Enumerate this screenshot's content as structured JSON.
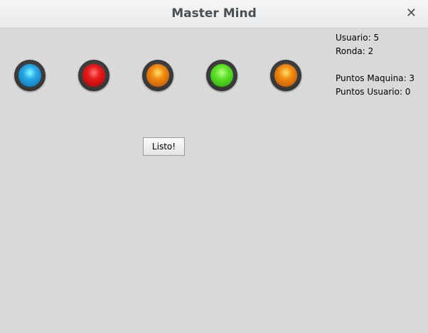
{
  "window": {
    "title": "Master Mind",
    "close_icon": "close-icon"
  },
  "pegs": [
    {
      "color_name": "blue",
      "color": "#2aa8e8"
    },
    {
      "color_name": "red",
      "color": "#e81c1c"
    },
    {
      "color_name": "orange",
      "color": "#f28a12"
    },
    {
      "color_name": "green",
      "color": "#5ee22a"
    },
    {
      "color_name": "orange",
      "color": "#f28a12"
    }
  ],
  "stats": {
    "usuario": "Usuario: 5",
    "ronda": "Ronda: 2",
    "puntos_maquina": "Puntos Maquina: 3",
    "puntos_usuario": "Puntos Usuario: 0"
  },
  "actions": {
    "listo_label": "Listo!"
  }
}
